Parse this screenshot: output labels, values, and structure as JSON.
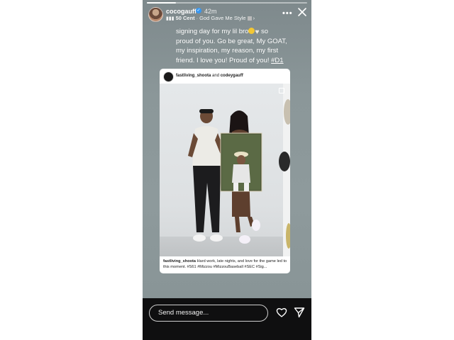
{
  "story": {
    "username": "cocogauff",
    "time": "42m",
    "music": {
      "artist": "50 Cent",
      "separator": "·",
      "song": "God Gave Me Style"
    },
    "caption": {
      "line1": "signing day for my lil bro",
      "line1_tail": " so",
      "line2": "proud of you. Go be great, My GOAT,",
      "line3": "my inspiration, my reason, my first",
      "line4": "friend. I love you! Proud of you!",
      "hashtag": "#D1"
    }
  },
  "post": {
    "author": "fastliving_shoota",
    "and": "and",
    "coauthor": "codeygauff",
    "caption_author": "fastliving_shoota",
    "caption_text": "Hard work, late nights, and love for the game led to this moment. #S61 #Mizzou #MizzouBaseball #SEC #Sig..."
  },
  "footer": {
    "send_placeholder": "Send message..."
  },
  "icons": {
    "more": "more-icon",
    "close": "close-icon",
    "heart": "heart-icon",
    "share": "send-icon",
    "verified": "verified-icon",
    "music": "music-bars-icon"
  },
  "colors": {
    "story_bg": "#8b9799",
    "verified": "#3897f0",
    "bottom_bar": "#0f0f10"
  }
}
